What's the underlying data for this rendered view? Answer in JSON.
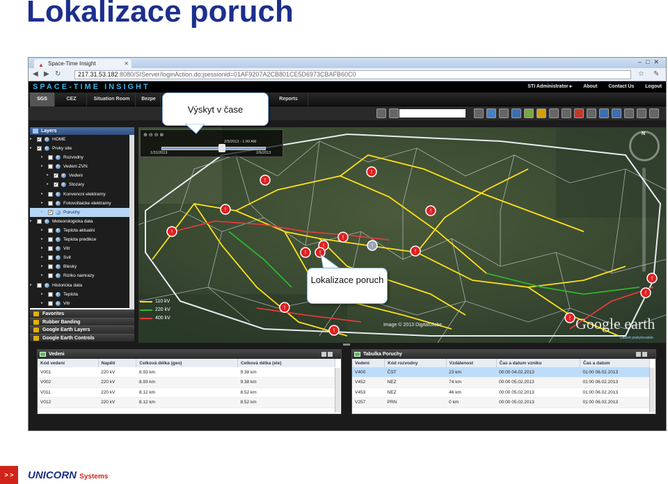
{
  "slide": {
    "title": "Lokalizace poruch",
    "callout_time": "Výskyt v čase",
    "callout_loc": "Lokalizace poruch"
  },
  "browser": {
    "tab_title": "Space-Time Insight",
    "url_host": "217.31.53.182",
    "url_rest": ":8080/SIServer/loginAction.do;jsessionid=01AF9207A2CB801CE5D6973CBAFB60C0"
  },
  "app": {
    "brand_a": "SPACE-TIME",
    "brand_b": " INSIGHT",
    "top_links": [
      "STI Administrator ▸",
      "About",
      "Contact Us",
      "Logout"
    ],
    "menu": [
      "SGS",
      "CEZ",
      "Situation Room",
      "Bezpe",
      "Reports"
    ]
  },
  "layers": {
    "header": "Layers",
    "rows": [
      {
        "label": "HOME",
        "indent": 0,
        "checked": true
      },
      {
        "label": "Prvky site",
        "indent": 0,
        "checked": true
      },
      {
        "label": "Rozvodny",
        "indent": 2,
        "checked": false
      },
      {
        "label": "Vedeni ZVN",
        "indent": 2,
        "checked": false
      },
      {
        "label": "Vedeni",
        "indent": 3,
        "checked": true
      },
      {
        "label": "Stozary",
        "indent": 3,
        "checked": true
      },
      {
        "label": "Konvencni elektrarny",
        "indent": 2,
        "checked": false
      },
      {
        "label": "Fotovoltaicke elektrarny",
        "indent": 2,
        "checked": false
      },
      {
        "label": "Poruchy",
        "indent": 2,
        "checked": true,
        "selected": true
      },
      {
        "label": "Meteorologicka data",
        "indent": 0,
        "checked": false
      },
      {
        "label": "Teplota aktualni",
        "indent": 2,
        "checked": false
      },
      {
        "label": "Teplota predikce",
        "indent": 2,
        "checked": false
      },
      {
        "label": "Vitr",
        "indent": 2,
        "checked": false
      },
      {
        "label": "Svit",
        "indent": 2,
        "checked": false
      },
      {
        "label": "Blesky",
        "indent": 2,
        "checked": false
      },
      {
        "label": "Riziko namrazy",
        "indent": 2,
        "checked": false
      },
      {
        "label": "Historicka data",
        "indent": 0,
        "checked": false
      },
      {
        "label": "Teplota",
        "indent": 2,
        "checked": false
      },
      {
        "label": "Vitr",
        "indent": 2,
        "checked": false
      }
    ],
    "accordions": [
      "Favorites",
      "Rubber Banding",
      "Google Earth Layers",
      "Google Earth Controls"
    ]
  },
  "timeslider": {
    "start": "1/31/2013",
    "current": "2/5/2013 - 1:00 AM",
    "end": "2/6/2013"
  },
  "legend": [
    {
      "label": "110 kV",
      "color": "#ffe11a"
    },
    {
      "label": "220 kV",
      "color": "#2fb52f"
    },
    {
      "label": "400 kV",
      "color": "#e23b3b"
    }
  ],
  "map": {
    "imagery": "Image © 2013 DigitalGlobe",
    "brand": "Google earth",
    "attribution": "Datové poskytovatele",
    "compass": "N"
  },
  "panel_left": {
    "title": "Vedeni",
    "columns": [
      "Kód vedení",
      "Napětí",
      "Celková délka (geo)",
      "Celková délka (ele)"
    ],
    "rows": [
      [
        "V001",
        "220 kV",
        "8.93 km",
        "9.38 km"
      ],
      [
        "V002",
        "220 kV",
        "8.93 km",
        "9.38 km"
      ],
      [
        "V011",
        "220 kV",
        "8.12 km",
        "8.52 km"
      ],
      [
        "V012",
        "220 kV",
        "8.12 km",
        "8.52 km"
      ]
    ]
  },
  "panel_right": {
    "title": "Tabulka Poruchy",
    "columns": [
      "Vedení",
      "Kód rozvodny",
      "Vzdálenost",
      "Čas a datum vzniku",
      "Čas a datum"
    ],
    "rows": [
      [
        "V400",
        "ČST",
        "23 km",
        "00:00 04.02.2013",
        "01:00 06.02.2013"
      ],
      [
        "V452",
        "NEZ",
        "74 km",
        "00:00 05.02.2013",
        "01:00 06.02.2013"
      ],
      [
        "V453",
        "NEZ",
        "46 km",
        "00:00 05.02.2013",
        "01:00 06.02.2013"
      ],
      [
        "V257",
        "PRN",
        "0 km",
        "00:00 05.02.2013",
        "01:00 06.02.2013"
      ]
    ]
  },
  "footer": {
    "arrow": "> >",
    "logo": "UNICORN",
    "logo_suffix": "Systems"
  }
}
